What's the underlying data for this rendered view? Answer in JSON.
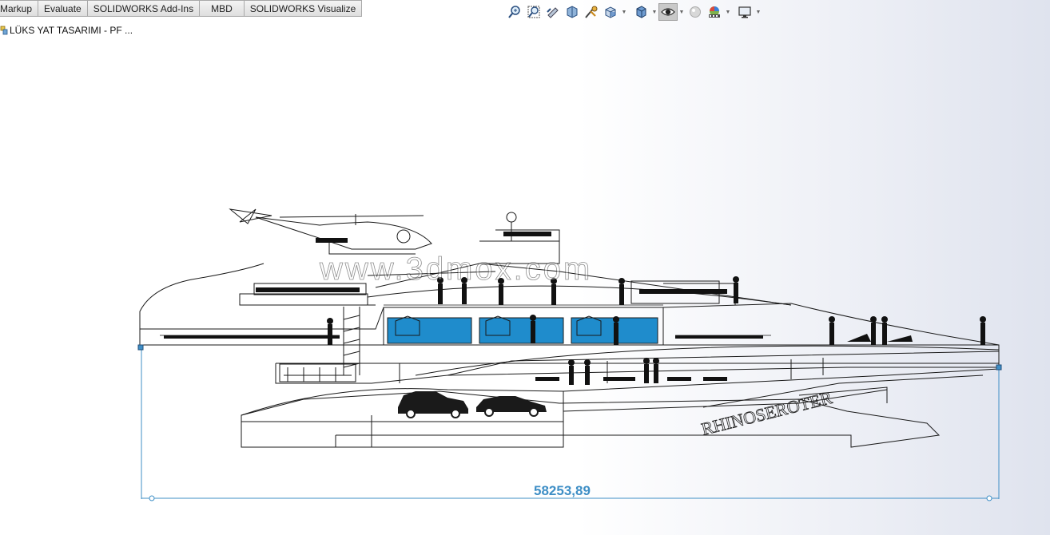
{
  "ribbon": {
    "tabs": [
      "Markup",
      "Evaluate",
      "SOLIDWORKS Add-Ins",
      "MBD",
      "SOLIDWORKS Visualize"
    ]
  },
  "document": {
    "title": "LÜKS YAT TASARIMI - PF ..."
  },
  "heads_up_toolbar": {
    "icons": [
      "zoom-to-fit-icon",
      "zoom-to-area-icon",
      "previous-view-icon",
      "section-view-icon",
      "dynamic-annotation-icon",
      "view-orientation-icon",
      "display-style-icon",
      "hide-show-items-icon",
      "edit-appearance-icon",
      "apply-scene-icon",
      "view-settings-icon"
    ]
  },
  "drawing": {
    "dimension_value": "58253,89",
    "hull_lettering": "RHINOSEROTER",
    "watermark": "www.3dmox.com",
    "accent_window_color": "#1f8ccc",
    "dimension_color": "#3f8fc6"
  }
}
